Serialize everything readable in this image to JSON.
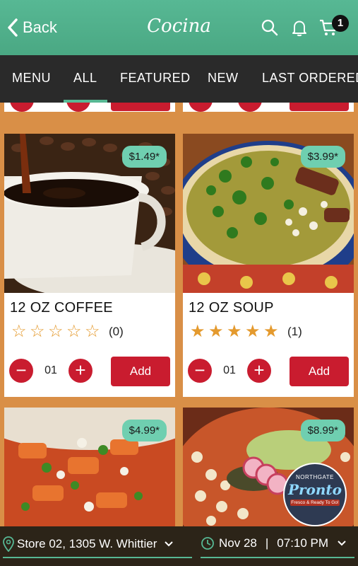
{
  "header": {
    "back_label": "Back",
    "title": "Cocina",
    "cart_count": "1"
  },
  "tabs": [
    "MENU",
    "ALL",
    "FEATURED",
    "NEW",
    "LAST ORDERED"
  ],
  "products": [
    {
      "name": "12 OZ COFFEE",
      "price": "$1.49*",
      "rating": 0,
      "rating_count": "(0)",
      "qty": "01",
      "add_label": "Add"
    },
    {
      "name": "12 OZ SOUP",
      "price": "$3.99*",
      "rating": 5,
      "rating_count": "(1)",
      "qty": "01",
      "add_label": "Add"
    },
    {
      "price": "$4.99*"
    },
    {
      "price": "$8.99*"
    }
  ],
  "logo": {
    "top": "NORTHGATE",
    "brand": "Pronto",
    "tagline": "Fresco & Ready To Go!"
  },
  "footer": {
    "store": "Store 02, 1305 W. Whittier",
    "date": "Nov 28",
    "separator": "|",
    "time": "07:10 PM"
  },
  "colors": {
    "accent": "#57b894",
    "primary_button": "#c91c2f",
    "star": "#e49a2e",
    "tabbar": "#2a2a2a"
  }
}
